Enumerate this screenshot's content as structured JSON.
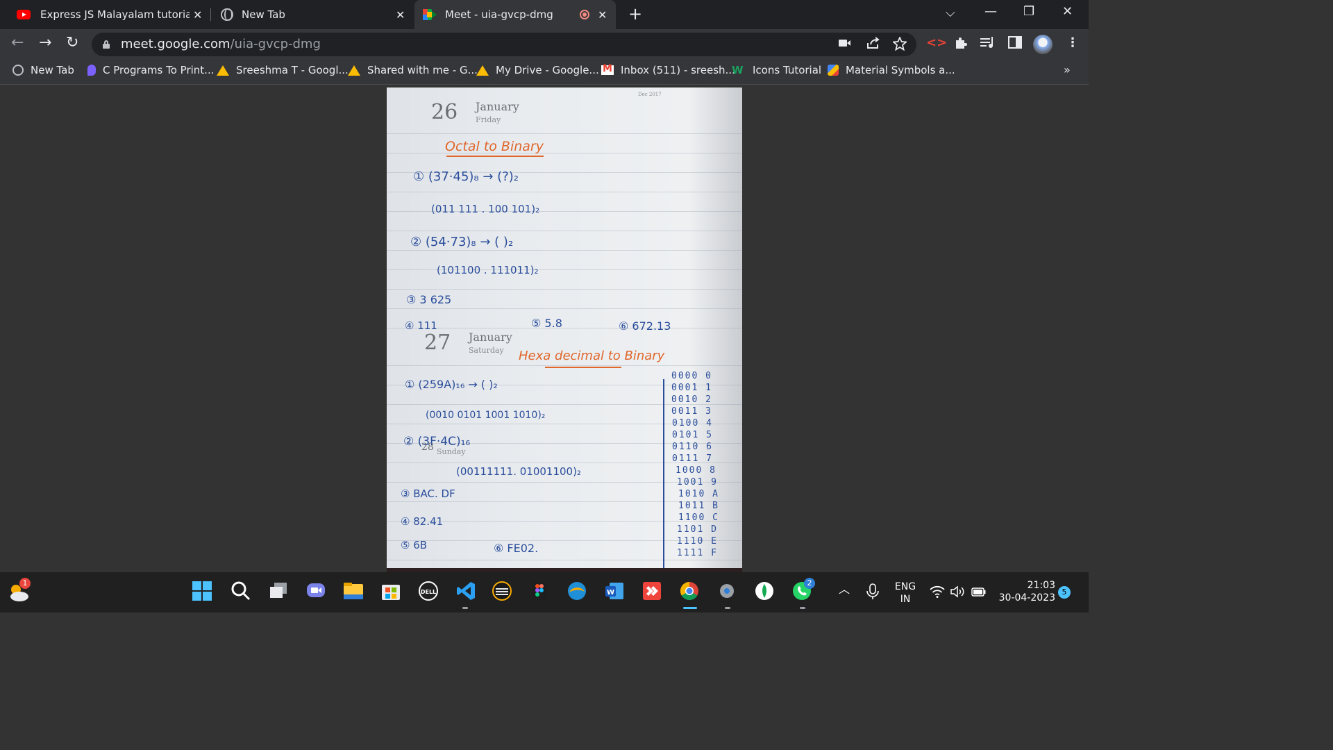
{
  "tabs": [
    {
      "title": "Express JS Malayalam tutorial | Pa",
      "close": "✕"
    },
    {
      "title": "New Tab",
      "close": "✕"
    },
    {
      "title": "Meet - uia-gvcp-dmg",
      "close": "✕"
    }
  ],
  "new_tab_symbol": "+",
  "window_controls": {
    "dropdown": "⌵",
    "minimize": "—",
    "restore": "❐",
    "close": "✕"
  },
  "address_bar": {
    "host": "meet.google.com",
    "path": "/uia-gvcp-dmg"
  },
  "nav": {
    "back": "←",
    "forward": "→",
    "reload": "↻"
  },
  "toolbar_icons": [
    "camera-icon",
    "share-icon",
    "star-icon",
    "code-extension-icon",
    "puzzle-extension-icon",
    "reading-list-icon",
    "side-panel-icon",
    "avatar",
    "menu-icon"
  ],
  "bookmarks": [
    {
      "label": "New Tab",
      "icon": "globe-icon"
    },
    {
      "label": "C Programs To Print...",
      "icon": "figma-p-icon"
    },
    {
      "label": "Sreeshma T - Googl...",
      "icon": "drive-icon"
    },
    {
      "label": "Shared with me - G...",
      "icon": "drive-icon"
    },
    {
      "label": "My Drive - Google...",
      "icon": "drive-icon"
    },
    {
      "label": "Inbox (511) - sreesh...",
      "icon": "gmail-icon"
    },
    {
      "label": "Icons Tutorial",
      "icon": "w3-icon"
    },
    {
      "label": "Material Symbols a...",
      "icon": "material-icon"
    }
  ],
  "bookmarks_more": "»",
  "notebook": {
    "page1": {
      "day_num": "26",
      "month": "January",
      "weekday": "Friday",
      "mini_cal_header": "Dec 2017"
    },
    "page2": {
      "day_num": "27",
      "month": "January",
      "weekday": "Saturday"
    },
    "page3": {
      "day_num": "28",
      "weekday": "Sunday"
    },
    "octal_heading": "Octal to Binary",
    "octal_lines": [
      "① (37·45)₈ → (?)₂",
      "(011 111 . 100 101)₂",
      "② (54·73)₈ → (  )₂",
      "(101100 . 111011)₂",
      "③ 3 625",
      "④ 111",
      "⑤ 5.8",
      "⑥ 672.13"
    ],
    "hex_heading": "Hexa decimal to Binary",
    "hex_lines": [
      "① (259A)₁₆ → (  )₂",
      "(0010 0101 1001 1010)₂",
      "② (3F·4C)₁₆",
      "(00111111. 01001100)₂",
      "③ BAC. DF",
      "④ 82.41",
      "⑤ 6B",
      "⑥ FE02."
    ],
    "hex_table": [
      "0000 0",
      "0001 1",
      "0010 2",
      "0011 3",
      "0100 4",
      "0101 5",
      "0110 6",
      "0111 7",
      "1000 8",
      "1001 9",
      "1010 A",
      "1011 B",
      "1100 C",
      "1101 D",
      "1110 E",
      "1111 F"
    ]
  },
  "taskbar": {
    "weather_badge": "1",
    "whatsapp_badge": "2",
    "language": "ENG",
    "region": "IN",
    "time": "21:03",
    "date": "30-04-2023",
    "notification_count": "5",
    "dell_label": "DELL",
    "word_label": "W"
  },
  "colors": {
    "tab_strip": "#202124",
    "active_tab": "#35363a",
    "taskbar": "#202020",
    "ink_orange": "#e0662a",
    "ink_blue": "#2a4d9b"
  }
}
